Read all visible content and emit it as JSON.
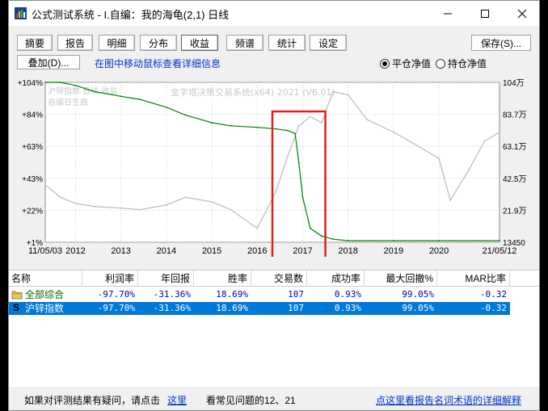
{
  "window": {
    "title": "公式测试系统 - I.自编：我的海龟(2,1) 日线",
    "min_symbol": "—",
    "max_symbol": "☐",
    "close_symbol": "✕"
  },
  "tabs": [
    {
      "label": "摘要",
      "active": false
    },
    {
      "label": "报告",
      "active": false
    },
    {
      "label": "明细",
      "active": false
    },
    {
      "label": "分布",
      "active": false
    },
    {
      "label": "收益",
      "active": true
    },
    {
      "label": "频谱",
      "active": false
    },
    {
      "label": "统计",
      "active": false
    },
    {
      "label": "设定",
      "active": false
    }
  ],
  "toolbar": {
    "save_label": "保存(S)...",
    "overlay_label": "叠加(D)...",
    "hint": "在图中移动鼠标查看详细信息",
    "radio_closed": "平仓净值",
    "radio_open": "持仓净值",
    "radio_closed_selected": true
  },
  "chart_data": {
    "type": "line",
    "watermark": "金字塔决策交易系统(x64) 2021 (V6.01)",
    "overlay_labels": [
      "沪锌指数  日线  收益",
      "自编日生曲"
    ],
    "left_axis_ticks": [
      "+104%",
      "+84%",
      "+63%",
      "+43%",
      "+22%",
      "+1%"
    ],
    "right_axis_ticks": [
      "104万",
      "83.7万",
      "63.1万",
      "42.5万",
      "21.9万",
      "13450"
    ],
    "x_axis_ticks": [
      "11/05/03",
      "2012",
      "2013",
      "2014",
      "2015",
      "2016",
      "2017",
      "2018",
      "2019",
      "2020",
      "21/05/12"
    ],
    "ylim_percent": [
      1,
      104
    ],
    "grid": true,
    "equity_series": {
      "name": "收益",
      "color": "#008000",
      "x": [
        "2011-05",
        "2011-09",
        "2012-01",
        "2012-06",
        "2013-01",
        "2013-06",
        "2014-01",
        "2014-06",
        "2015-01",
        "2015-06",
        "2016-01",
        "2016-06",
        "2016-09",
        "2016-11",
        "2016-12",
        "2017-01",
        "2017-03",
        "2017-06",
        "2017-09",
        "2018-01",
        "2019-01",
        "2020-01",
        "2021-05"
      ],
      "y": [
        104,
        104,
        102,
        98,
        95,
        93,
        88,
        83,
        78,
        76,
        75,
        74,
        73,
        71,
        52,
        30,
        10,
        5,
        3,
        2,
        2,
        2,
        2
      ]
    },
    "price_series": {
      "name": "沪锌指数",
      "color": "#bbbbbb",
      "x": [
        "2011-05",
        "2011-09",
        "2012-01",
        "2012-06",
        "2013-01",
        "2013-06",
        "2014-01",
        "2014-06",
        "2015-01",
        "2015-06",
        "2016-01",
        "2016-06",
        "2016-09",
        "2016-12",
        "2017-03",
        "2017-06",
        "2017-09",
        "2018-01",
        "2018-06",
        "2019-01",
        "2019-06",
        "2020-01",
        "2020-04",
        "2020-09",
        "2021-01",
        "2021-05"
      ],
      "y": [
        38,
        30,
        26,
        24,
        23,
        22,
        25,
        30,
        27,
        22,
        10,
        34,
        56,
        76,
        82,
        78,
        98,
        96,
        80,
        72,
        65,
        55,
        28,
        48,
        66,
        72
      ]
    },
    "highlight_range": [
      "2016-05",
      "2017-07"
    ],
    "highlight_color": "#e02020"
  },
  "table": {
    "headers": [
      "名称",
      "利润率",
      "年回报",
      "胜率",
      "交易数",
      "成功率",
      "最大回撤%",
      "MAR比率"
    ],
    "rows": [
      {
        "name": "全部综合",
        "values": [
          "-97.70%",
          "-31.36%",
          "18.69%",
          "107",
          "0.93%",
          "99.05%",
          "-0.32"
        ],
        "selected": false
      },
      {
        "name": "沪锌指数",
        "values": [
          "-97.70%",
          "-31.36%",
          "18.69%",
          "107",
          "0.93%",
          "99.05%",
          "-0.32"
        ],
        "selected": true,
        "mark": "S"
      }
    ]
  },
  "status": {
    "prefix": "如果对评测结果有疑问，请点击",
    "link": "这里",
    "faq": "看常见问题的12、21",
    "right_link": "点这里看报告名词术语的详细解释"
  }
}
